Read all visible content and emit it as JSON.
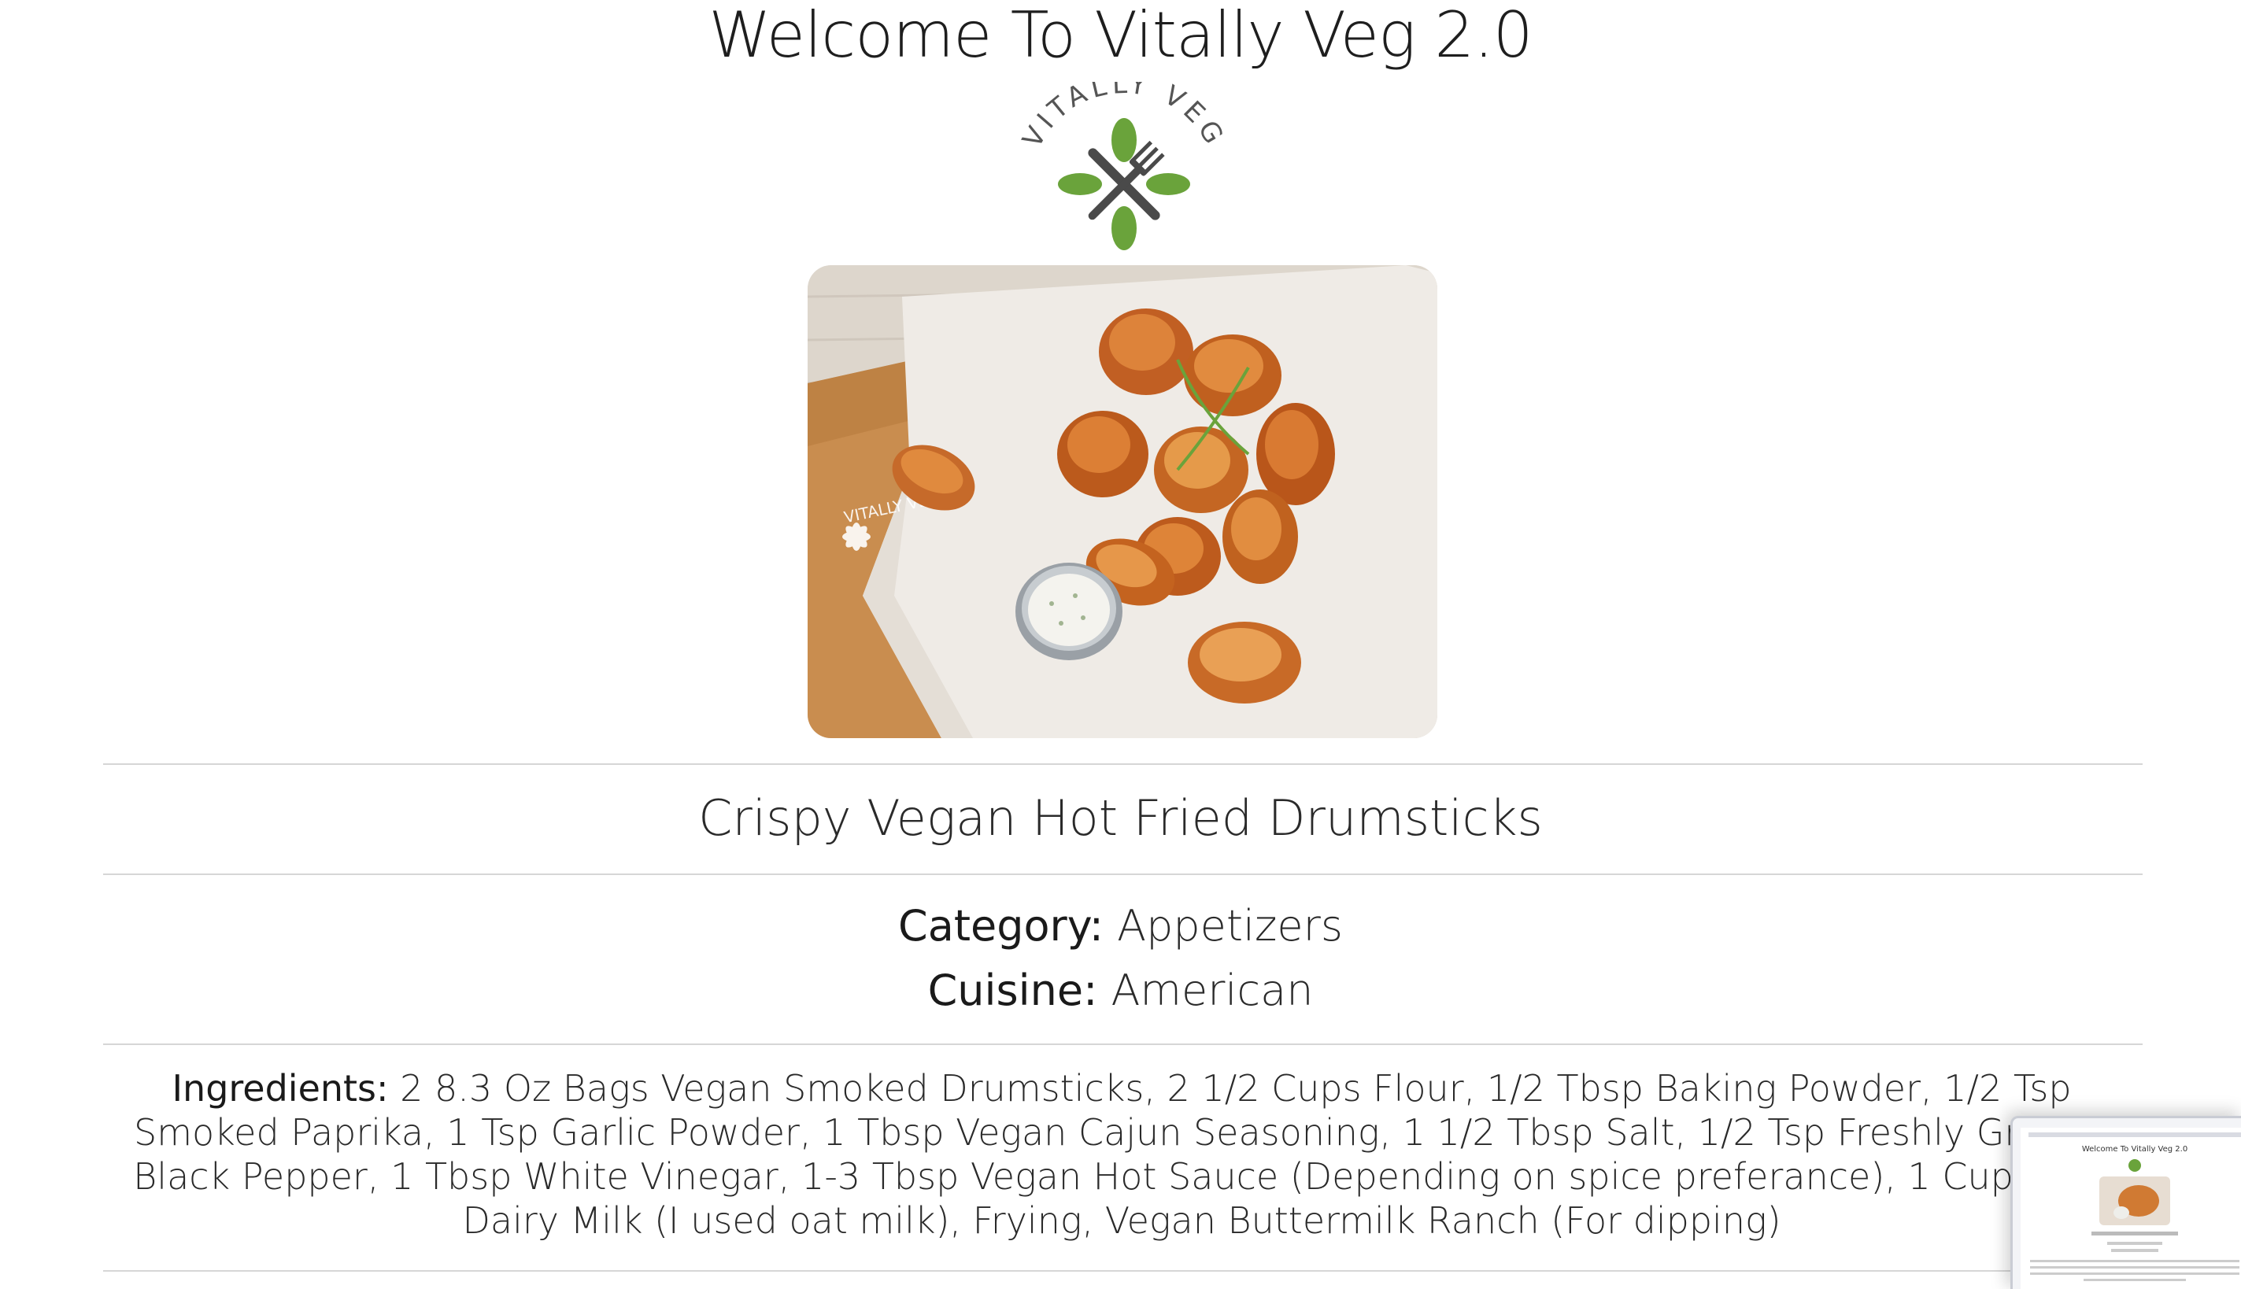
{
  "page": {
    "title": "Welcome To Vitally Veg 2.0"
  },
  "logo": {
    "text": "VITALLY VEG",
    "leaf_color": "#6aa33b",
    "utensil_color": "#4a4a4a"
  },
  "recipe": {
    "name": "Crispy Vegan Hot Fried Drumsticks",
    "category_label": "Category:",
    "category": "Appetizers",
    "cuisine_label": "Cuisine:",
    "cuisine": "American",
    "ingredients_label": "Ingredients:",
    "ingredients": "2 8.3 Oz Bags Vegan Smoked Drumsticks, 2 1/2 Cups Flour, 1/2 Tbsp Baking Powder, 1/2 Tsp Smoked Paprika, 1 Tsp Garlic Powder, 1 Tbsp Vegan Cajun Seasoning, 1 1/2 Tbsp Salt, 1/2 Tsp Freshly Ground Black Pepper, 1 Tbsp White Vinegar, 1-3 Tbsp Vegan Hot Sauce (Depending on spice preferance), 1 Cup Non-Dairy Milk (I used oat milk), Frying, Vegan Buttermilk Ranch (For dipping)"
  },
  "colors": {
    "rule": "#d6d6d6",
    "text": "#2a2a2a"
  },
  "thumbnail": {
    "title": "Welcome To Vitally Veg 2.0"
  }
}
